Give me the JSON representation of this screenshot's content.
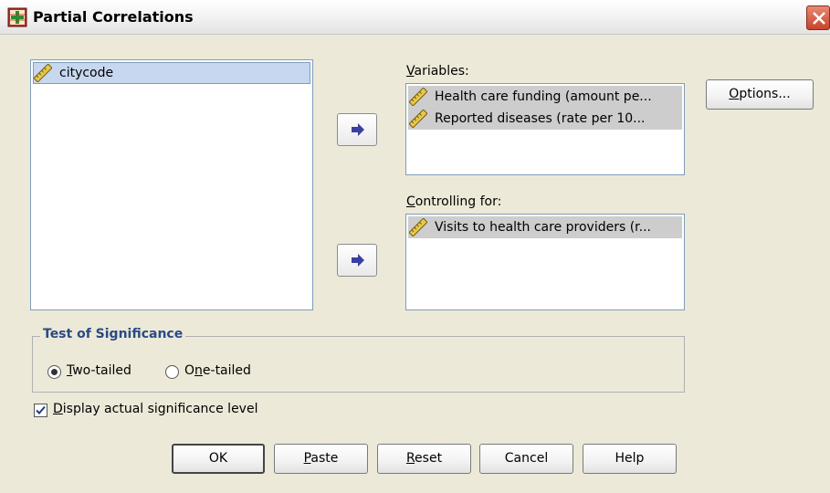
{
  "window": {
    "title": "Partial Correlations"
  },
  "source_list": {
    "items": [
      {
        "label": "citycode",
        "icon": "scale-ruler-icon",
        "selected": true
      }
    ]
  },
  "variables": {
    "label_prefix": "",
    "label_underline": "V",
    "label_rest": "ariables:",
    "items": [
      {
        "label": "Health care funding (amount pe...",
        "icon": "scale-ruler-icon"
      },
      {
        "label": "Reported diseases (rate per 10...",
        "icon": "scale-ruler-icon"
      }
    ]
  },
  "controlling": {
    "label_underline": "C",
    "label_rest": "ontrolling for:",
    "items": [
      {
        "label": "Visits to health care providers (r...",
        "icon": "scale-ruler-icon"
      }
    ]
  },
  "options_button": {
    "underline": "O",
    "rest": "ptions..."
  },
  "significance": {
    "title": "Test of Significance",
    "two_tailed": {
      "underline": "T",
      "rest": "wo-tailed",
      "checked": true
    },
    "one_tailed": {
      "prefix": "O",
      "underline": "n",
      "rest": "e-tailed",
      "checked": false
    }
  },
  "display_level": {
    "underline": "D",
    "rest": "isplay actual significance level",
    "checked": true
  },
  "buttons": {
    "ok": "OK",
    "paste_underline": "P",
    "paste_rest": "aste",
    "reset_underline": "R",
    "reset_rest": "eset",
    "cancel": "Cancel",
    "help": "Help"
  },
  "colors": {
    "dialog_bg": "#ece9d8",
    "list_selection": "#c6d7ef",
    "group_title": "#2a4a86",
    "close_button": "#c8432c"
  }
}
